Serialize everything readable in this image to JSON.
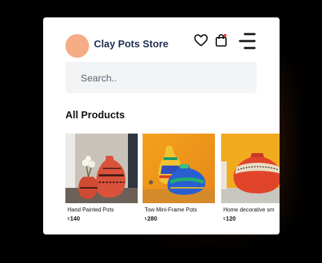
{
  "header": {
    "store_name": "Clay Pots Store",
    "avatar_color": "#f6ad86"
  },
  "search": {
    "placeholder": "Search.."
  },
  "section": {
    "title": "All Products"
  },
  "products": [
    {
      "name": "Hand Painted Pots",
      "currency": "$",
      "price": "140",
      "image": "terracotta-painted-pots-photo"
    },
    {
      "name": "Tow Mini-Frame Pots",
      "currency": "$",
      "price": "280",
      "image": "colorful-mini-pots-photo"
    },
    {
      "name": "Home decorative sm",
      "currency": "$",
      "price": "120",
      "image": "orange-decorative-pot-photo"
    }
  ],
  "icons": [
    "heart-icon",
    "shopping-bag-icon",
    "menu-icon"
  ],
  "colors": {
    "title_text": "#1f2f52",
    "search_bg": "#f3f4f6",
    "notification_dot": "#e53935"
  }
}
